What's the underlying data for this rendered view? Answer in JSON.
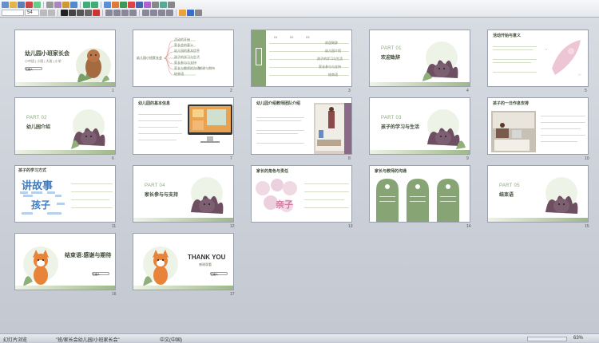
{
  "toolbar": {
    "font_name": "",
    "font_size": "54"
  },
  "slides": [
    {
      "num": "1",
      "title": "幼儿园小班家长会",
      "subtitle": "小中班 | 小班 | 大班 | 小学",
      "btn": "汇报人"
    },
    {
      "num": "2",
      "center": "幼儿园小班家长会",
      "items": [
        "活动的开始",
        "家长会的意义",
        "幼儿园的基本信息",
        "孩子的学习与生活",
        "家长参与与支持",
        "家长与教师的沟通",
        "结束语",
        "感谢与期待"
      ]
    },
    {
      "num": "3",
      "cols": [
        "01",
        "02",
        "03"
      ],
      "rows": [
        "欢迎致辞",
        "幼儿园介绍",
        "孩子的学习与生活",
        "家长参与与支持",
        "结束语"
      ]
    },
    {
      "num": "4",
      "part": "PART 01",
      "title": "欢迎致辞"
    },
    {
      "num": "5",
      "title": "活动开始与意义"
    },
    {
      "num": "6",
      "part": "PART 02",
      "title": "幼儿园介绍"
    },
    {
      "num": "7",
      "title": "幼儿园的基本信息"
    },
    {
      "num": "8",
      "title": "幼儿园介绍教师团队介绍"
    },
    {
      "num": "9",
      "part": "PART 03",
      "title": "孩子的学习与生活"
    },
    {
      "num": "10",
      "title": "孩子的一日作息安排"
    },
    {
      "num": "11",
      "title": "孩子的学习方式",
      "words": [
        "讲故事",
        "孩子"
      ]
    },
    {
      "num": "12",
      "part": "PART 04",
      "title": "家长参与与支持"
    },
    {
      "num": "13",
      "title": "家长的角色与责任",
      "words": [
        "亲子"
      ]
    },
    {
      "num": "14",
      "title": "家长与教师的沟通"
    },
    {
      "num": "15",
      "part": "PART 05",
      "title": "结束语"
    },
    {
      "num": "16",
      "title": "结束语:感谢与期待",
      "btn": "汇报人"
    },
    {
      "num": "17",
      "title": "THANK YOU",
      "sub": "感谢观看",
      "btn": "汇报人"
    }
  ],
  "status": {
    "slide_info": "幻灯片浏览",
    "file_name": "\"班/家长会幼儿园/小班家长会\"",
    "lang": "中文(中国)",
    "zoom": "63%"
  },
  "colors": {
    "green_dark": "#6e8f5e",
    "green_light": "#b8cda5",
    "pink": "#d98aa8"
  }
}
